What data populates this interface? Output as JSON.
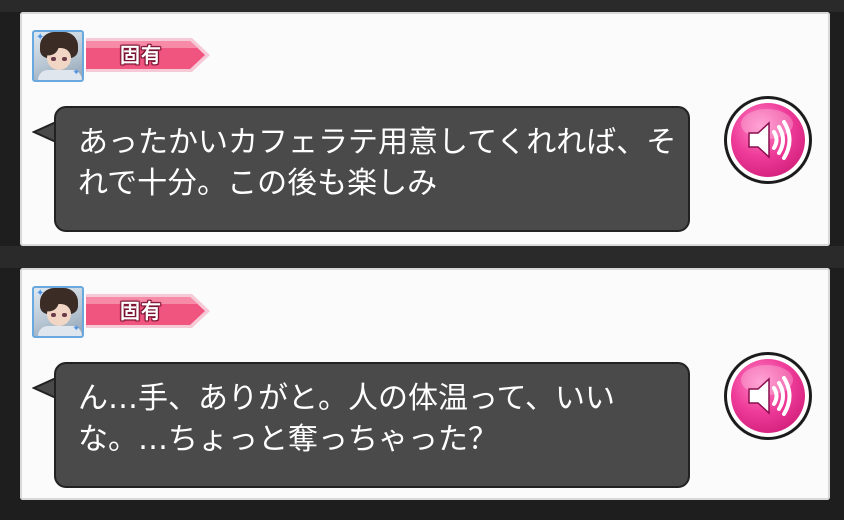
{
  "cards": [
    {
      "tag_label": "固有",
      "dialogue": "あったかいカフェラテ用意してくれれば、それで十分。この後も楽しみ"
    },
    {
      "tag_label": "固有",
      "dialogue": "ん…手、ありがと。人の体温って、いいな。…ちょっと奪っちゃった？"
    }
  ],
  "icons": {
    "voice": "speaker-icon",
    "avatar": "character-portrait"
  },
  "colors": {
    "tag_pink": "#f0557f",
    "voice_pink": "#ee3a98",
    "bubble_bg": "#4a4a4a",
    "card_bg": "#fbfbfb"
  }
}
